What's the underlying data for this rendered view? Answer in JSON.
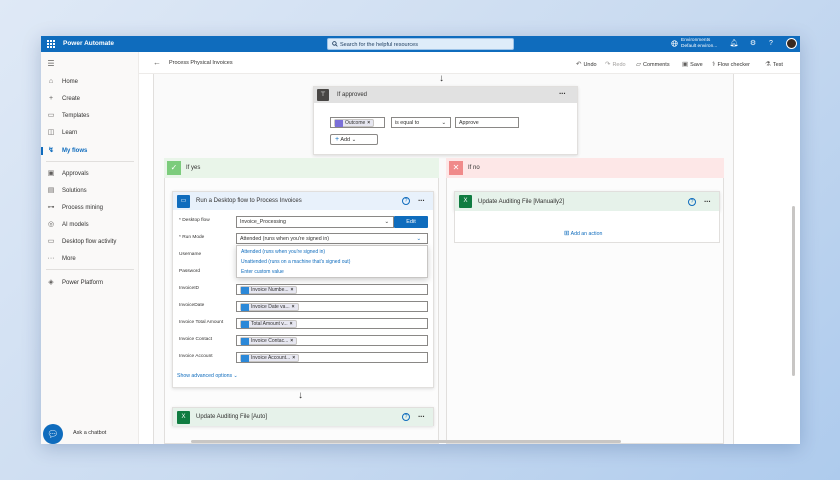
{
  "app": {
    "title": "Power Automate"
  },
  "search": {
    "placeholder": "Search for the helpful resources"
  },
  "environment": {
    "label": "Environments",
    "name": "Default environ..."
  },
  "nav": {
    "items": [
      {
        "label": "Home",
        "icon": "home-icon"
      },
      {
        "label": "Create",
        "icon": "plus-icon"
      },
      {
        "label": "Templates",
        "icon": "template-icon"
      },
      {
        "label": "Learn",
        "icon": "book-icon"
      },
      {
        "label": "My flows",
        "icon": "flow-icon"
      },
      {
        "label": "Approvals",
        "icon": "approvals-icon"
      },
      {
        "label": "Solutions",
        "icon": "solutions-icon"
      },
      {
        "label": "Process mining",
        "icon": "process-mining-icon"
      },
      {
        "label": "AI models",
        "icon": "ai-models-icon"
      },
      {
        "label": "Desktop flow activity",
        "icon": "desktop-activity-icon"
      },
      {
        "label": "More",
        "icon": "more-icon"
      },
      {
        "label": "Power Platform",
        "icon": "power-platform-icon"
      }
    ],
    "chatbot": "Ask a chatbot"
  },
  "cmdbar": {
    "flow_name": "Process Physical Invoices",
    "undo": "Undo",
    "redo": "Redo",
    "comments": "Comments",
    "save": "Save",
    "checker": "Flow checker",
    "test": "Test"
  },
  "condition": {
    "title": "If approved",
    "token": "Outcome",
    "operator": "is equal to",
    "value": "Approve",
    "add": "Add"
  },
  "branches": {
    "yes": "If yes",
    "no": "If no"
  },
  "desktop_action": {
    "title": "Run a Desktop flow to Process Invoices",
    "desktop_flow_label": "* Desktop flow",
    "desktop_flow_value": "Invoice_Processing",
    "edit": "Edit",
    "run_mode_label": "* Run Mode",
    "run_mode_value": "Attended (runs when you're signed in)",
    "run_mode_options": [
      "Attended (runs when you're signed in)",
      "Unattended (runs on a machine that's signed out)",
      "Enter custom value"
    ],
    "username_label": "Username",
    "password_label": "Password",
    "params": [
      {
        "label": "InvoiceID",
        "token": "Invoice Numbe..."
      },
      {
        "label": "InvoiceDate",
        "token": "Invoice Date va..."
      },
      {
        "label": "Invoice Total Amount",
        "token": "Total Amount v..."
      },
      {
        "label": "Invoice Contact",
        "token": "Invoice Contac..."
      },
      {
        "label": "Invoice Account",
        "token": "Invoice Account..."
      }
    ],
    "advanced": "Show advanced options"
  },
  "auto_action": {
    "title": "Update Auditing File [Auto]"
  },
  "manual_action": {
    "title": "Update Auditing File [Manually2]",
    "add_action": "Add an action"
  },
  "colors": {
    "brand": "#0f6cbd",
    "yes": "#e9f5e9",
    "no": "#fde7e7",
    "excel": "#107c41"
  }
}
